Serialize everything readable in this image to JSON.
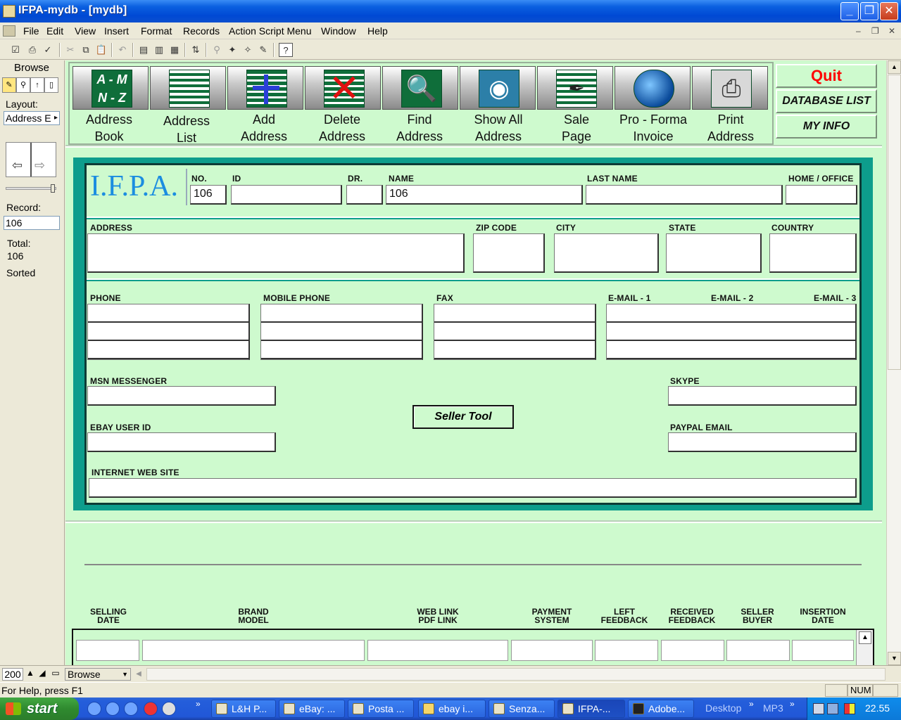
{
  "window": {
    "title": "IFPA-mydb - [mydb]"
  },
  "menu": [
    "File",
    "Edit",
    "View",
    "Insert",
    "Format",
    "Records",
    "Action Script Menu",
    "Window",
    "Help"
  ],
  "status": {
    "mode": "Browse",
    "layout_label": "Layout:",
    "layout_value": "Address E",
    "record_label": "Record:",
    "record_value": "106",
    "total_label": "Total:",
    "total_value": "106",
    "sorted_label": "Sorted"
  },
  "nav": [
    {
      "line1": "Address",
      "line2": "Book",
      "tile": "A - M\nN - Z",
      "icon": "az-index-icon"
    },
    {
      "line1": "Address",
      "line2": "List",
      "tile": "",
      "icon": "list-icon"
    },
    {
      "line1": "Add",
      "line2": "Address",
      "tile": "",
      "icon": "add-icon"
    },
    {
      "line1": "Delete",
      "line2": "Address",
      "tile": "",
      "icon": "delete-icon"
    },
    {
      "line1": "Find",
      "line2": "Address",
      "tile": "",
      "icon": "magnifier-icon"
    },
    {
      "line1": "Show All",
      "line2": "Address",
      "tile": "",
      "icon": "eye-icon"
    },
    {
      "line1": "Sale",
      "line2": "Page",
      "tile": "",
      "icon": "quill-icon"
    },
    {
      "line1": "Pro - Forma",
      "line2": "Invoice",
      "tile": "",
      "icon": "globe-icon"
    },
    {
      "line1": "Print",
      "line2": "Address",
      "tile": "",
      "icon": "printer-icon"
    }
  ],
  "right_buttons": {
    "quit": "Quit",
    "database_list": "DATABASE LIST",
    "my_info": "MY INFO"
  },
  "logo": "I.F.P.A.",
  "fields": {
    "no": {
      "label": "NO.",
      "value": "106"
    },
    "id": {
      "label": "ID",
      "value": ""
    },
    "dr": {
      "label": "DR.",
      "value": ""
    },
    "name": {
      "label": "NAME",
      "value": "106"
    },
    "last_name": {
      "label": "LAST NAME",
      "value": ""
    },
    "home_office": {
      "label": "HOME / OFFICE",
      "value": ""
    },
    "address": {
      "label": "ADDRESS",
      "value": ""
    },
    "zip": {
      "label": "ZIP CODE",
      "value": ""
    },
    "city": {
      "label": "CITY",
      "value": ""
    },
    "state": {
      "label": "STATE",
      "value": ""
    },
    "country": {
      "label": "COUNTRY",
      "value": ""
    },
    "phone": {
      "label": "PHONE"
    },
    "mobile": {
      "label": "MOBILE PHONE"
    },
    "fax": {
      "label": "FAX"
    },
    "email1": {
      "label": "E-MAIL - 1"
    },
    "email2": {
      "label": "E-MAIL - 2"
    },
    "email3": {
      "label": "E-MAIL - 3"
    },
    "msn": {
      "label": "MSN MESSENGER"
    },
    "skype": {
      "label": "SKYPE"
    },
    "ebay": {
      "label": "EBAY USER ID"
    },
    "paypal": {
      "label": "PAYPAL EMAIL"
    },
    "web": {
      "label": "INTERNET WEB SITE"
    }
  },
  "seller_tool": "Seller Tool",
  "table_headers": [
    {
      "l1": "SELLING",
      "l2": "DATE"
    },
    {
      "l1": "BRAND",
      "l2": "MODEL"
    },
    {
      "l1": "WEB LINK",
      "l2": "PDF LINK"
    },
    {
      "l1": "PAYMENT",
      "l2": "SYSTEM"
    },
    {
      "l1": "LEFT",
      "l2": "FEEDBACK"
    },
    {
      "l1": "RECEIVED",
      "l2": "FEEDBACK"
    },
    {
      "l1": "SELLER",
      "l2": "BUYER"
    },
    {
      "l1": "INSERTION",
      "l2": "DATE"
    }
  ],
  "bottom": {
    "zoom": "200",
    "mode_select": "Browse",
    "help": "For Help, press F1",
    "num": "NUM"
  },
  "taskbar": {
    "start": "start",
    "items": [
      "L&H P...",
      "eBay: ...",
      "Posta ...",
      "ebay i...",
      "Senza...",
      "IFPA-...",
      "Adobe..."
    ],
    "desktop": "Desktop",
    "mp3": "MP3",
    "clock": "22.55"
  }
}
